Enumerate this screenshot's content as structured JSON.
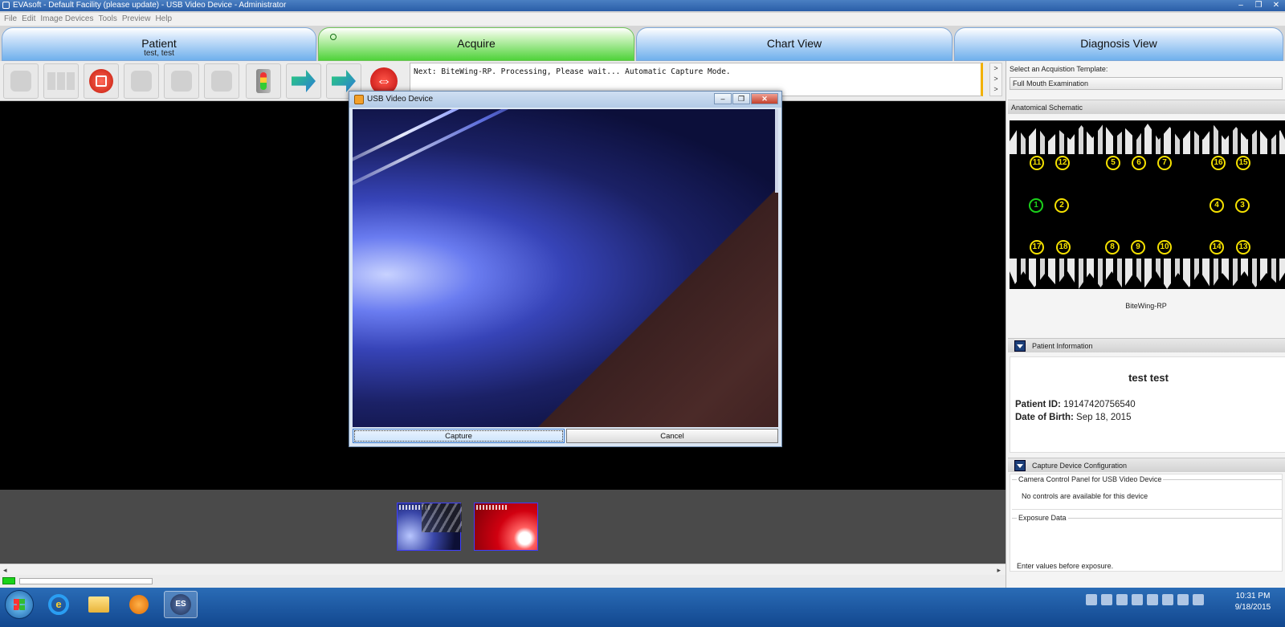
{
  "window": {
    "title": "EVAsoft - Default Facility (please update) - USB Video Device - Administrator",
    "controls": [
      "–",
      "❐",
      "✕"
    ]
  },
  "menu": [
    "File",
    "Edit",
    "Image Devices",
    "Tools",
    "Preview",
    "Help"
  ],
  "tabs": [
    {
      "title": "Patient",
      "subtitle": "test, test"
    },
    {
      "title": "Acquire",
      "subtitle": ""
    },
    {
      "title": "Chart View",
      "subtitle": ""
    },
    {
      "title": "Diagnosis View",
      "subtitle": ""
    }
  ],
  "status_message": "Next: BiteWing-RP.  Processing, Please wait...  Automatic Capture Mode.",
  "scroll_arrows": [
    ">",
    ">",
    ">"
  ],
  "template": {
    "label": "Select an Acquistion Template:",
    "selected": "Full Mouth Examination"
  },
  "schematic": {
    "header": "Anatomical Schematic",
    "caption": "BiteWing-RP",
    "selected_tooth": "1",
    "top_numbers": [
      "11",
      "12",
      "5",
      "6",
      "7",
      "16",
      "15"
    ],
    "middle_numbers": [
      "1",
      "2",
      "4",
      "3"
    ],
    "bottom_numbers": [
      "17",
      "18",
      "8",
      "9",
      "10",
      "14",
      "13"
    ]
  },
  "patient": {
    "header": "Patient Information",
    "name": "test test",
    "id_label": "Patient ID:",
    "id_value": "19147420756540",
    "dob_label": "Date of Birth:",
    "dob_value": "Sep 18, 2015"
  },
  "capture_config": {
    "header": "Capture Device Configuration",
    "panel_title": "Camera Control Panel for USB Video Device",
    "no_controls": "No controls are available for this device",
    "exposure_title": "Exposure Data",
    "exposure_note": "Enter values before exposure."
  },
  "dialog": {
    "title": "USB Video Device",
    "capture_label": "Capture",
    "cancel_label": "Cancel"
  },
  "hscroll": {
    "left": "◂",
    "right": "▸"
  },
  "taskbar": {
    "es_label": "ES",
    "ie_label": "e",
    "time": "10:31 PM",
    "date": "9/18/2015"
  }
}
